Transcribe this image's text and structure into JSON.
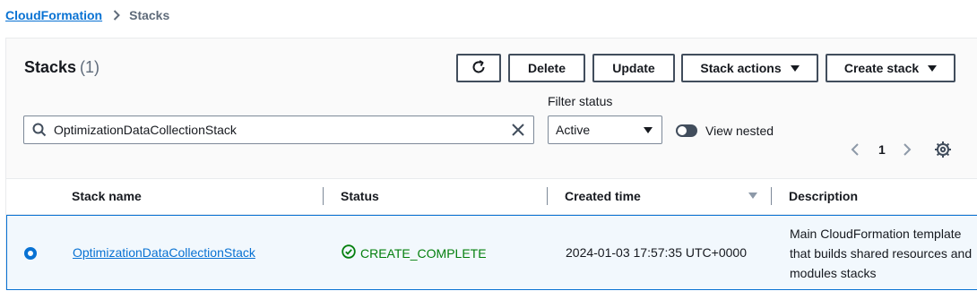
{
  "breadcrumb": {
    "root": "CloudFormation",
    "current": "Stacks"
  },
  "header": {
    "title": "Stacks",
    "count": "(1)"
  },
  "toolbar": {
    "refresh_icon": "refresh-icon",
    "delete_label": "Delete",
    "update_label": "Update",
    "stack_actions_label": "Stack actions",
    "create_stack_label": "Create stack"
  },
  "search": {
    "value": "OptimizationDataCollectionStack"
  },
  "filter": {
    "label": "Filter status",
    "selected": "Active"
  },
  "toggle": {
    "label": "View nested",
    "on": false
  },
  "pagination": {
    "page": "1"
  },
  "table": {
    "columns": [
      "Stack name",
      "Status",
      "Created time",
      "Description"
    ],
    "rows": [
      {
        "selected": true,
        "stack_name": "OptimizationDataCollectionStack",
        "status": "CREATE_COMPLETE",
        "created_time": "2024-01-03 17:57:35 UTC+0000",
        "description": "Main CloudFormation template that builds shared resources and modules stacks"
      }
    ]
  },
  "colors": {
    "link": "#0972d3",
    "success": "#037f0c",
    "text": "#16191f",
    "selected_row_bg": "#f2f8fd"
  }
}
